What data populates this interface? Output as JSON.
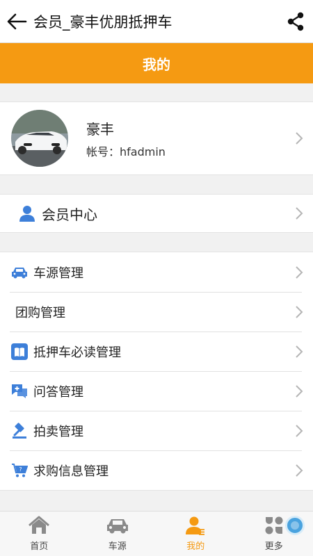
{
  "header": {
    "title": "会员_豪丰优朋抵押车",
    "back_icon": "back-arrow-icon",
    "share_icon": "share-icon"
  },
  "page_title": "我的",
  "profile": {
    "name": "豪丰",
    "account": "帐号：hfadmin"
  },
  "member_center": {
    "label": "会员中心",
    "icon": "person-icon"
  },
  "menu": {
    "items": [
      {
        "label": "车源管理",
        "icon": "car-icon"
      },
      {
        "label": "团购管理",
        "icon": ""
      },
      {
        "label": "抵押车必读管理",
        "icon": "book-icon"
      },
      {
        "label": "问答管理",
        "icon": "qa-chat-icon"
      },
      {
        "label": "拍卖管理",
        "icon": "auction-hammer-icon"
      },
      {
        "label": "求购信息管理",
        "icon": "shopping-cart-icon"
      }
    ]
  },
  "tabbar": {
    "tabs": [
      {
        "label": "首页",
        "icon": "home-icon"
      },
      {
        "label": "车源",
        "icon": "car-icon"
      },
      {
        "label": "我的",
        "icon": "profile-icon",
        "active": true
      },
      {
        "label": "更多",
        "icon": "more-grid-icon"
      }
    ]
  },
  "colors": {
    "accent": "#f59a12",
    "icon_blue": "#3d7fd9",
    "chevron": "#b5b5b5"
  }
}
